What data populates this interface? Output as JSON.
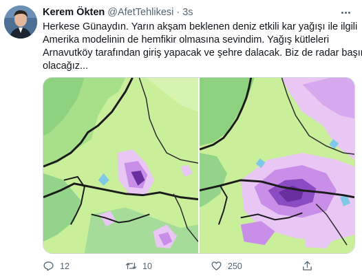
{
  "author": {
    "name": "Kerem Ökten",
    "handle": "@AfetTehlikesi",
    "separator": "·",
    "time": "3s"
  },
  "tweet": {
    "lines": [
      "Herkese Günaydın. Yarın akşam beklenen deniz etkili kar yağışı ile ilgili",
      "Amerika modelinin de hemfikir olmasına sevindim. Yağış kütleleri",
      "Arnavutköy tarafından giriş yapacak ve şehre dalacak. Biz de radar başında",
      "olacağız..."
    ]
  },
  "media": [
    {
      "icon": "snow-forecast-map-left"
    },
    {
      "icon": "snow-forecast-map-right"
    }
  ],
  "actions": {
    "reply": {
      "icon": "reply-icon",
      "count": "12"
    },
    "retweet": {
      "icon": "retweet-icon",
      "count": "10"
    },
    "like": {
      "icon": "heart-icon",
      "count": "250"
    },
    "share": {
      "icon": "share-icon"
    }
  },
  "colors": {
    "text": "#0f1419",
    "secondary": "#536471",
    "map_land": "#c9ef9a",
    "map_forest": "#8ed17e",
    "map_snow_light": "#e9c7f5",
    "map_snow_mid": "#c98ee8",
    "map_snow_heavy": "#6a2f9e",
    "map_ice": "#7ec8e8"
  }
}
